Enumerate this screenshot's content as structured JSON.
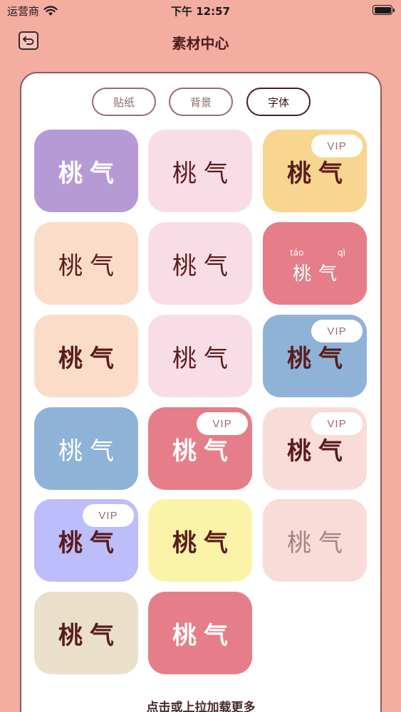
{
  "status_bar": {
    "carrier": "运营商",
    "time": "下午 12:57"
  },
  "nav": {
    "title": "素材中心"
  },
  "tabs": [
    {
      "label": "贴纸",
      "active": false
    },
    {
      "label": "背景",
      "active": false
    },
    {
      "label": "字体",
      "active": true
    }
  ],
  "tiles": [
    {
      "text": "桃气",
      "bg": "#b69ad6",
      "color": "#ffffff",
      "vip": false,
      "weight": "900"
    },
    {
      "text": "桃气",
      "bg": "#f9dde6",
      "color": "#5a1c1c",
      "vip": false,
      "weight": "normal"
    },
    {
      "text": "桃气",
      "bg": "#f8d690",
      "color": "#5a1c1c",
      "vip": true,
      "weight": "bold"
    },
    {
      "text": "桃气",
      "bg": "#fbdcc8",
      "color": "#5a1c1c",
      "vip": false,
      "weight": "normal"
    },
    {
      "text": "桃气",
      "bg": "#f9dde6",
      "color": "#5a1c1c",
      "vip": false,
      "weight": "normal"
    },
    {
      "text": "桃气",
      "bg": "#e57e89",
      "color": "#ffffff",
      "vip": false,
      "weight": "normal",
      "pinyin": [
        "táo",
        "qì"
      ]
    },
    {
      "text": "桃气",
      "bg": "#fbdcc8",
      "color": "#5a1c1c",
      "vip": false,
      "weight": "bold"
    },
    {
      "text": "桃气",
      "bg": "#f9dde6",
      "color": "#5a1c1c",
      "vip": false,
      "weight": "normal"
    },
    {
      "text": "桃气",
      "bg": "#8fb3d6",
      "color": "#5a1c1c",
      "vip": true,
      "weight": "bold"
    },
    {
      "text": "桃气",
      "bg": "#8fb3d6",
      "color": "#ffffff",
      "vip": false,
      "weight": "normal"
    },
    {
      "text": "桃气",
      "bg": "#e57e89",
      "color": "#ffffff",
      "vip": true,
      "weight": "900"
    },
    {
      "text": "桃气",
      "bg": "#f9dcd8",
      "color": "#5a1c1c",
      "vip": true,
      "weight": "bold"
    },
    {
      "text": "桃气",
      "bg": "#bdbdfc",
      "color": "#5a1c1c",
      "vip": true,
      "weight": "900"
    },
    {
      "text": "桃气",
      "bg": "#fbf4a8",
      "color": "#5a1c1c",
      "vip": false,
      "weight": "bold"
    },
    {
      "text": "桃气",
      "bg": "#f9dcd8",
      "color": "#a38484",
      "vip": false,
      "weight": "normal"
    },
    {
      "text": "桃气",
      "bg": "#eae0ca",
      "color": "#5a1c1c",
      "vip": false,
      "weight": "bold"
    },
    {
      "text": "桃气",
      "bg": "#e57e89",
      "color": "#ffffff",
      "vip": false,
      "weight": "900"
    }
  ],
  "vip_label": "VIP",
  "load_more": "点击或上拉加载更多",
  "icons": {
    "back": "back-arrow-icon",
    "wifi": "wifi-icon",
    "battery": "battery-icon"
  }
}
